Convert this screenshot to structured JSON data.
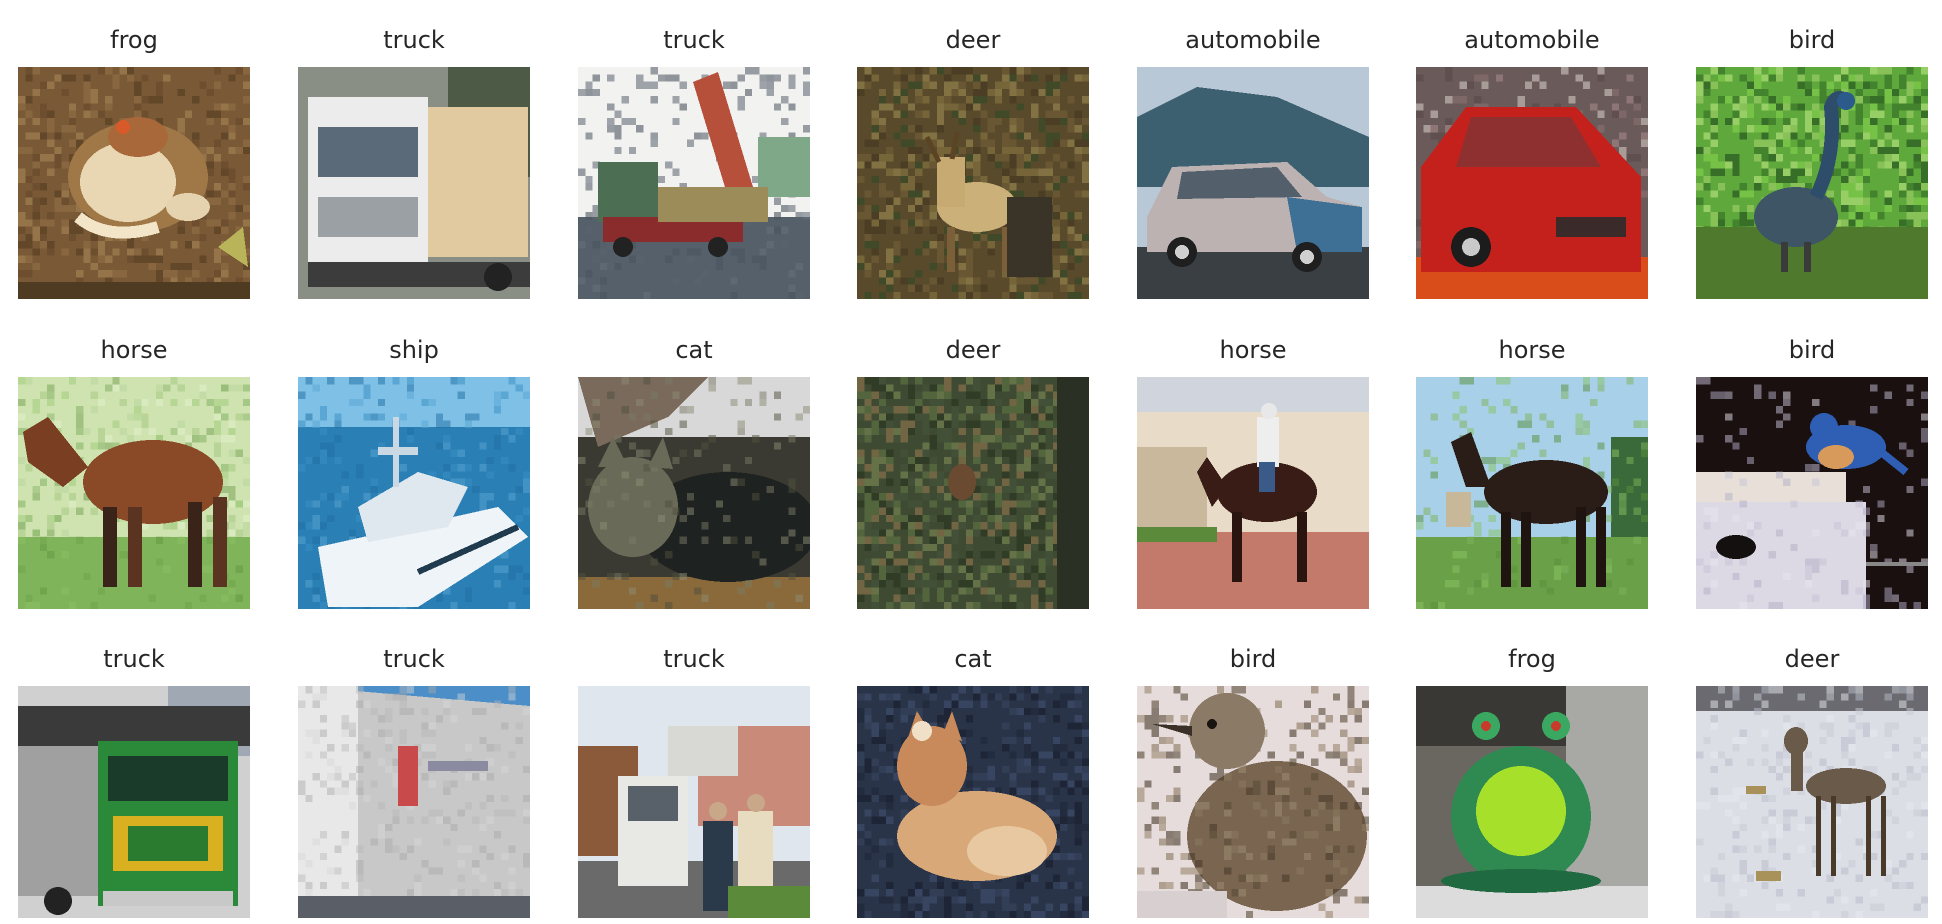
{
  "cells": [
    {
      "label": "frog",
      "scene": "frog"
    },
    {
      "label": "truck",
      "scene": "truck-white"
    },
    {
      "label": "truck",
      "scene": "truck-dump"
    },
    {
      "label": "deer",
      "scene": "deer-forest"
    },
    {
      "label": "automobile",
      "scene": "car-silver"
    },
    {
      "label": "automobile",
      "scene": "car-red"
    },
    {
      "label": "bird",
      "scene": "bird-peacock"
    },
    {
      "label": "horse",
      "scene": "horse-brown"
    },
    {
      "label": "ship",
      "scene": "ship-boat"
    },
    {
      "label": "cat",
      "scene": "cat-dark"
    },
    {
      "label": "deer",
      "scene": "deer-bush"
    },
    {
      "label": "horse",
      "scene": "horse-rider"
    },
    {
      "label": "horse",
      "scene": "horse-black"
    },
    {
      "label": "bird",
      "scene": "bird-blue"
    },
    {
      "label": "truck",
      "scene": "truck-green"
    },
    {
      "label": "truck",
      "scene": "truck-trailer"
    },
    {
      "label": "truck",
      "scene": "truck-people"
    },
    {
      "label": "cat",
      "scene": "cat-ginger"
    },
    {
      "label": "bird",
      "scene": "bird-brown"
    },
    {
      "label": "frog",
      "scene": "frog-statue"
    },
    {
      "label": "deer",
      "scene": "deer-snow"
    }
  ]
}
